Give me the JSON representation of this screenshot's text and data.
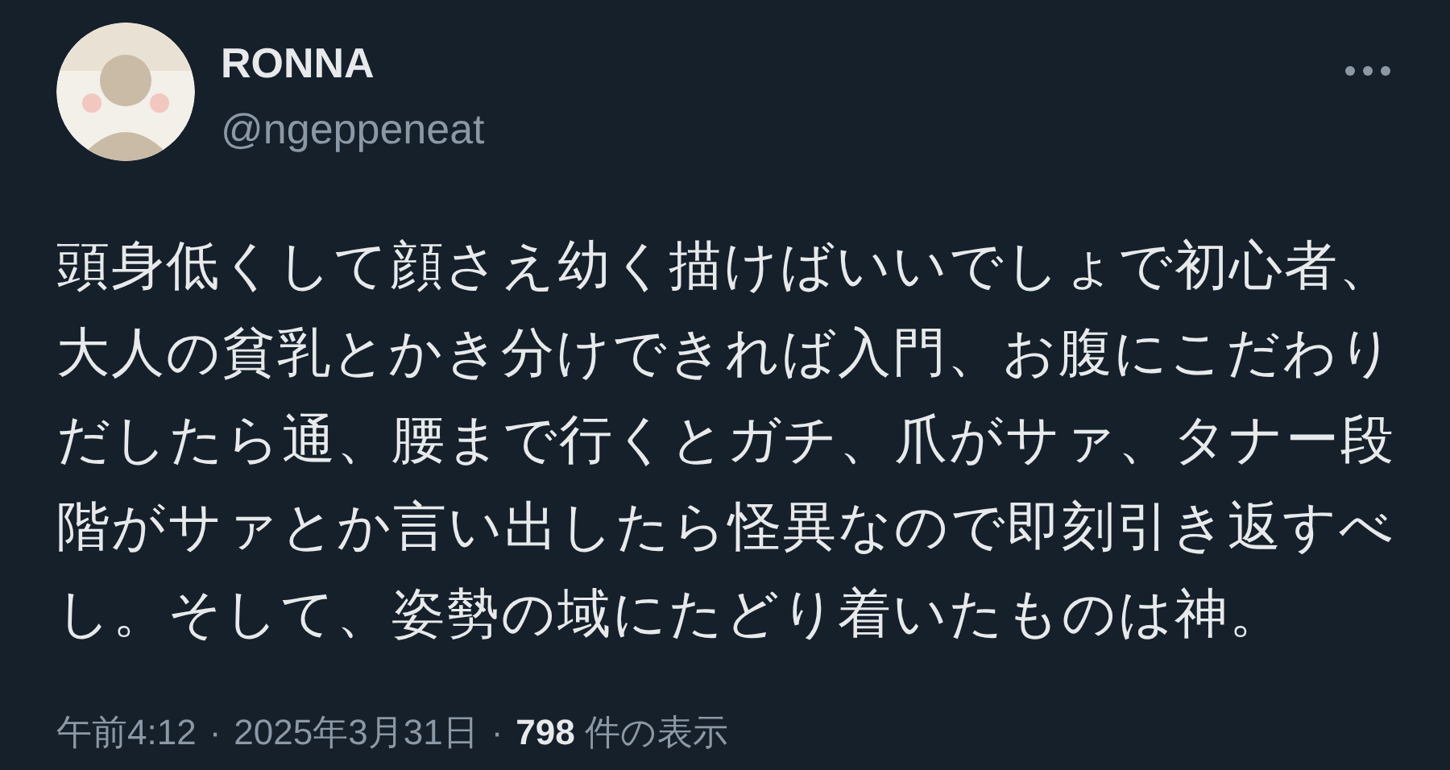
{
  "author": {
    "name": "RONNA",
    "handle": "@ngeppeneat"
  },
  "body": "頭身低くして顔さえ幼く描けばいいでしょで初心者、大人の貧乳とかき分けできれば入門、お腹にこだわりだしたら通、腰まで行くとガチ、爪がサァ、タナー段階がサァとか言い出したら怪異なので即刻引き返すべし。そして、姿勢の域にたどり着いたものは神。",
  "meta": {
    "time": "午前4:12",
    "date": "2025年3月31日",
    "views_count": "798",
    "views_label": "件の表示",
    "separator": "·"
  }
}
